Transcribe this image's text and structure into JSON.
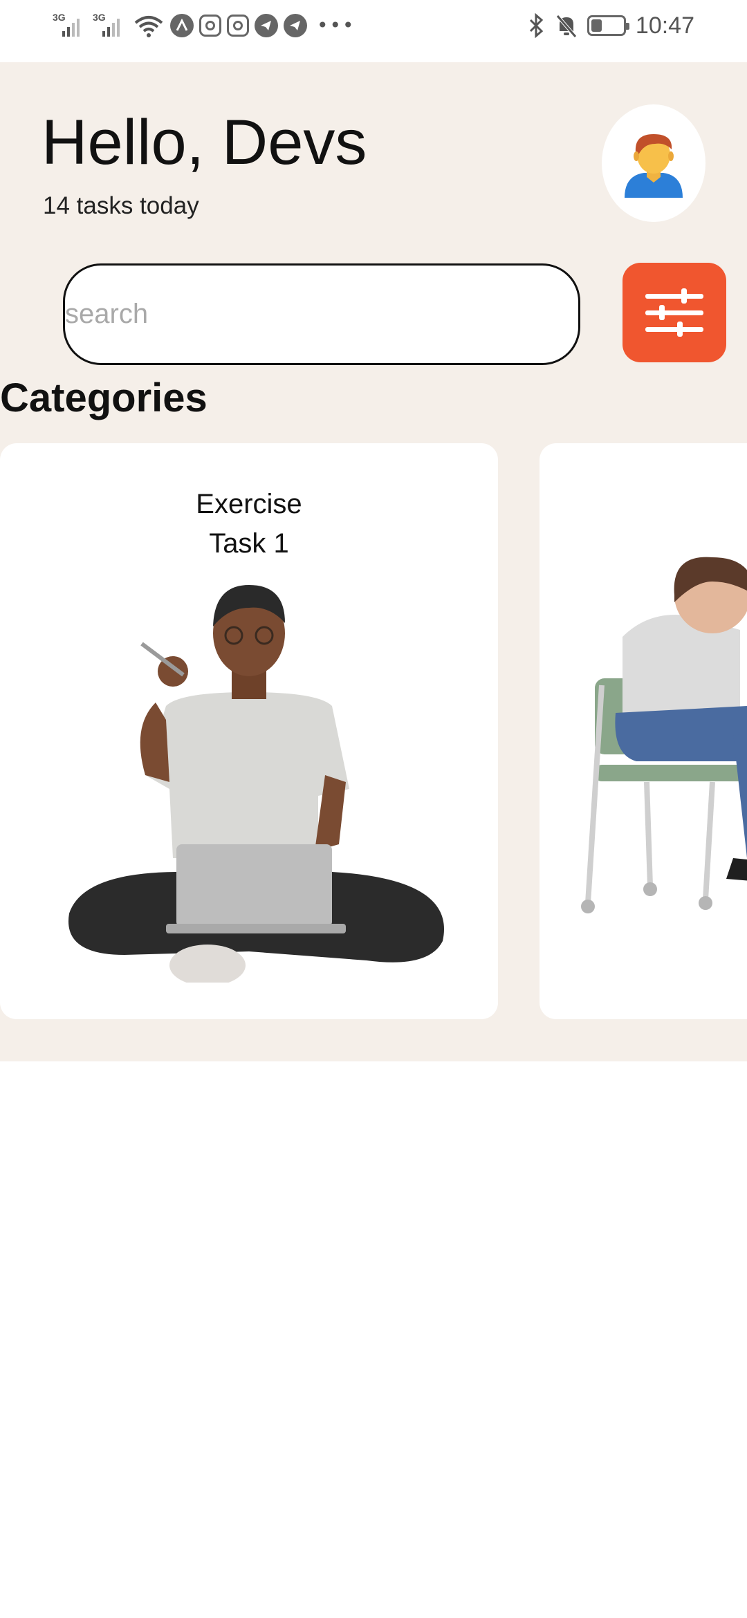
{
  "status_bar": {
    "network_1": "3G",
    "network_2": "3G",
    "time": "10:47",
    "icons": [
      "signal-icon",
      "signal-icon",
      "wifi-icon",
      "app-notification-icon",
      "instagram-icon",
      "instagram-icon",
      "telegram-icon",
      "telegram-icon",
      "more-icon",
      "bluetooth-icon",
      "mute-icon",
      "battery-icon"
    ],
    "battery_level": 0.35
  },
  "header": {
    "greeting": "Hello, Devs",
    "subtitle": "14 tasks today",
    "avatar_icon": "person-avatar-icon"
  },
  "search": {
    "placeholder": "search",
    "value": ""
  },
  "filter": {
    "icon": "sliders-icon",
    "color": "#f0562f"
  },
  "categories": {
    "title": "Categories",
    "cards": [
      {
        "line1": "Exercise",
        "line2": "Task 1",
        "image": "person-sitting-with-laptop-illustration"
      },
      {
        "line1": "",
        "line2": "",
        "image": "person-sitting-on-chair-illustration"
      }
    ]
  },
  "colors": {
    "background": "#f5efe9",
    "card": "#ffffff",
    "accent": "#f0562f"
  }
}
